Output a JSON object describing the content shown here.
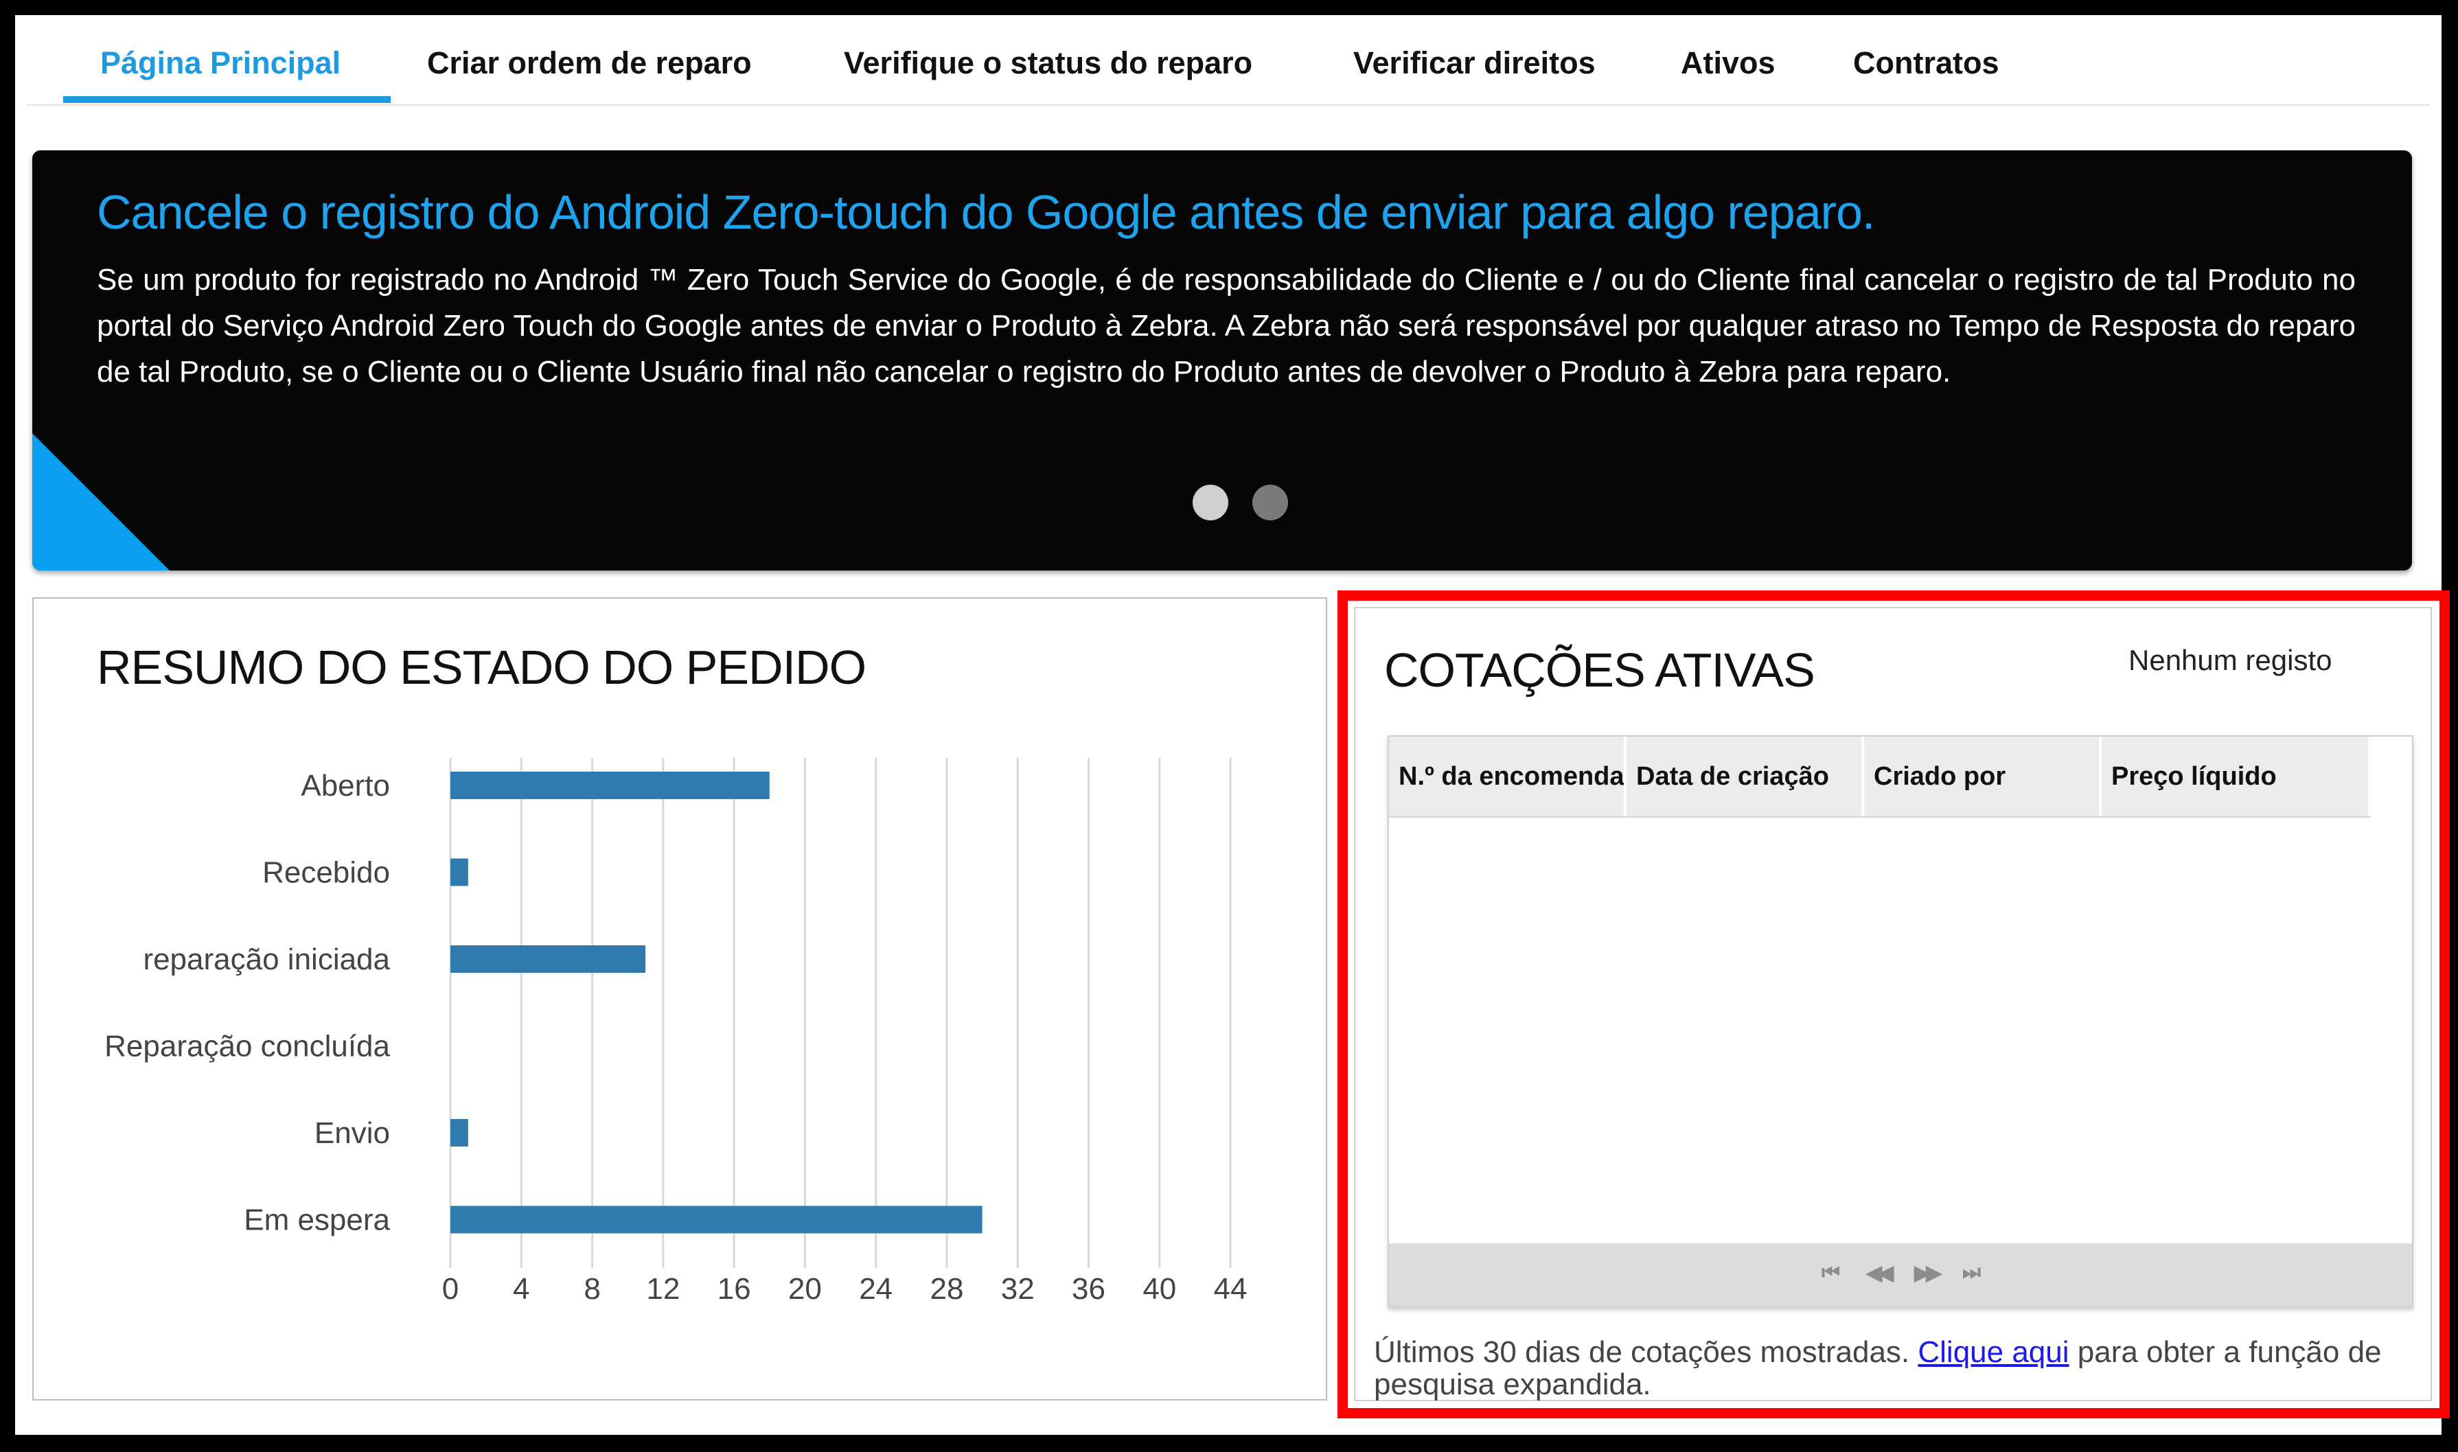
{
  "nav": {
    "tabs": [
      {
        "label": "Página Principal",
        "active": true
      },
      {
        "label": "Criar ordem de reparo"
      },
      {
        "label": "Verifique o status do reparo"
      },
      {
        "label": "Verificar direitos"
      },
      {
        "label": "Ativos"
      },
      {
        "label": "Contratos"
      }
    ]
  },
  "banner": {
    "title": "Cancele o registro do Android Zero-touch do Google antes de enviar para algo reparo.",
    "body": "Se um produto for registrado no Android ™ Zero Touch Service do Google, é de responsabilidade do Cliente e / ou do Cliente final cancelar o registro de tal Produto no portal do Serviço Android Zero Touch do Google antes de enviar o Produto à Zebra. A Zebra não será responsável por qualquer atraso no Tempo de Resposta do reparo de tal Produto, se o Cliente ou o Cliente Usuário final não cancelar o registro do Produto antes de devolver o Produto à Zebra para reparo.",
    "slides": 2,
    "active_slide": 1,
    "accent_color": "#0aa0ef"
  },
  "summary": {
    "title": "RESUMO DO ESTADO DO PEDIDO"
  },
  "chart_data": {
    "type": "bar",
    "orientation": "horizontal",
    "categories": [
      "Aberto",
      "Recebido",
      "reparação iniciada",
      "Reparação concluída",
      "Envio",
      "Em espera"
    ],
    "values": [
      18,
      1,
      11,
      0,
      1,
      30
    ],
    "xticks": [
      "0",
      "4",
      "8",
      "12",
      "16",
      "20",
      "24",
      "28",
      "32",
      "36",
      "40",
      "44"
    ],
    "xlim": [
      0,
      44
    ],
    "grid": true,
    "bar_color": "#2f7bb0",
    "title": "",
    "xlabel": "",
    "ylabel": ""
  },
  "quotes": {
    "title": "COTAÇÕES ATIVAS",
    "no_records": "Nenhum registo",
    "columns": [
      "N.º da encomenda",
      "Data de criação",
      "Criado por",
      "Preço líquido"
    ],
    "rows": [],
    "pager": {
      "first": "⏮",
      "prev": "◀◀",
      "next": "▶▶",
      "last": "⏭"
    },
    "footer_prefix": "Últimos 30 dias de cotações mostradas. ",
    "footer_link": "Clique aqui",
    "footer_suffix": " para obter a função de pesquisa expandida.",
    "highlight_color": "#ff0000"
  }
}
